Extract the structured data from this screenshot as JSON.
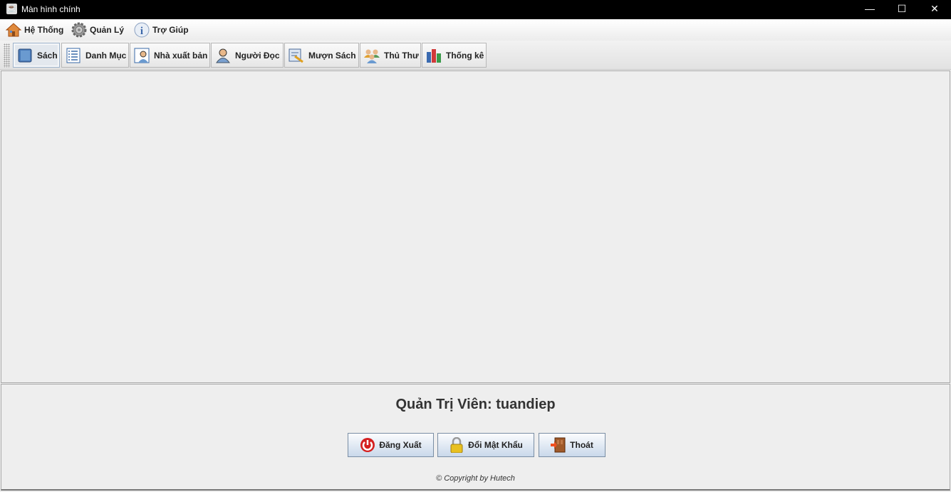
{
  "window": {
    "title": "Màn hình chính",
    "minimize": "—",
    "maximize": "☐",
    "close": "✕"
  },
  "menu": [
    {
      "label": "Hệ Thống",
      "icon": "house-icon"
    },
    {
      "label": "Quản Lý",
      "icon": "gear-icon"
    },
    {
      "label": "Trợ Giúp",
      "icon": "info-icon"
    }
  ],
  "toolbar": [
    {
      "label": "Sách",
      "icon": "book-icon",
      "selected": true
    },
    {
      "label": "Danh Mục",
      "icon": "list-icon"
    },
    {
      "label": "Nhà xuất bản",
      "icon": "publisher-icon"
    },
    {
      "label": "Người Đọc",
      "icon": "reader-icon"
    },
    {
      "label": "Mượn Sách",
      "icon": "borrow-icon"
    },
    {
      "label": "Thủ Thư",
      "icon": "librarian-icon"
    },
    {
      "label": "Thống kê",
      "icon": "chart-icon"
    }
  ],
  "footer": {
    "admin_label": "Quản Trị Viên:  tuandiep",
    "logout": "Đăng Xuất",
    "change_password": "Đổi Mật Khẩu",
    "exit": "Thoát",
    "copyright": "© Copyright by Hutech"
  }
}
